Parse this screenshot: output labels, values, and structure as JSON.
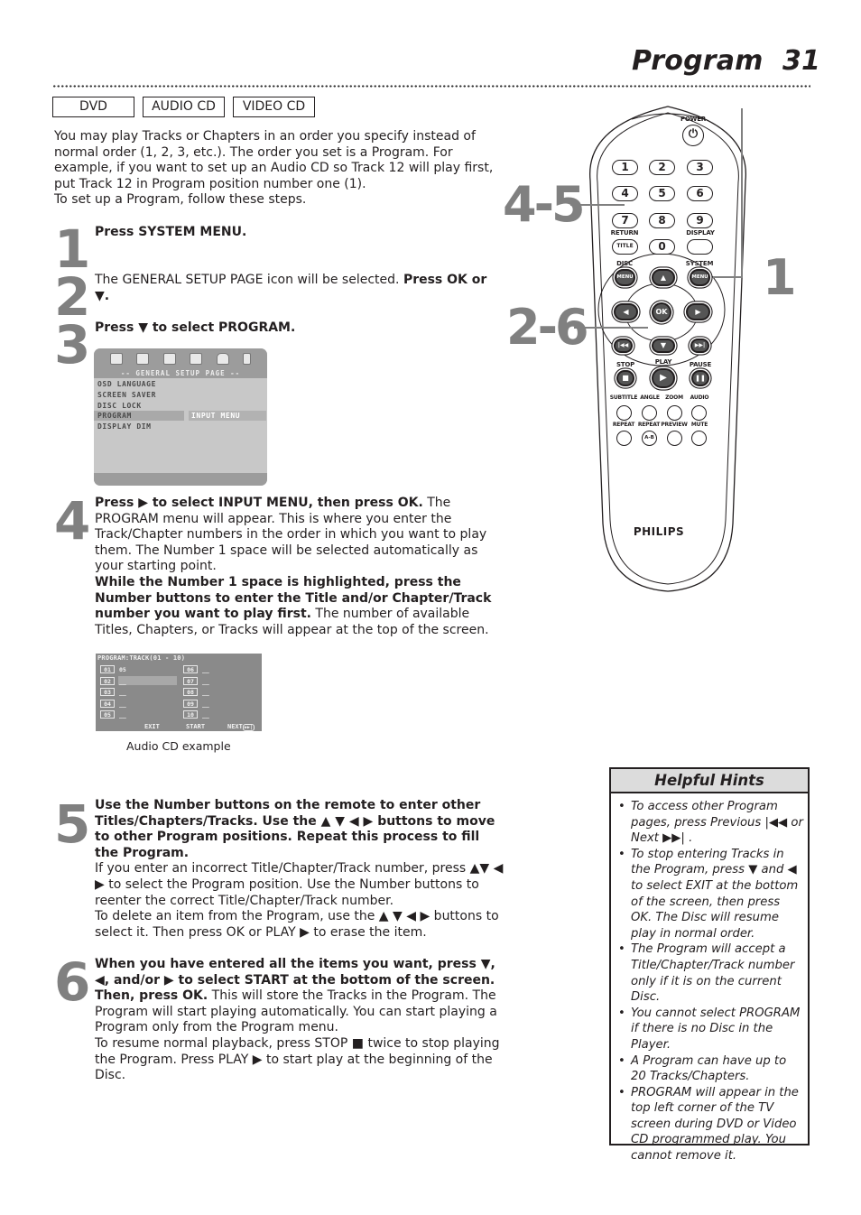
{
  "header": {
    "title": "Program",
    "page_number": "31"
  },
  "disc_types": [
    "DVD",
    "AUDIO CD",
    "VIDEO CD"
  ],
  "intro": {
    "paragraph": "You may play Tracks or Chapters in an order you specify instead of normal order (1, 2, 3, etc.). The order you set is a Program. For example, if you want to set up an Audio CD so Track 12 will play first, put Track 12 in Program position number one (1).",
    "followup": "To set up a Program, follow these steps."
  },
  "steps": [
    {
      "number": "1",
      "bold": "Press SYSTEM MENU.",
      "text": ""
    },
    {
      "number": "2",
      "pre": "The GENERAL SETUP PAGE icon will be selected. ",
      "bold": "Press OK or ▼."
    },
    {
      "number": "3",
      "bold": "Press ▼ to select PROGRAM."
    },
    {
      "number": "4",
      "bold1": "Press ▶ to select INPUT MENU, then press OK.",
      "text1": " The PROGRAM menu will appear. This is where you enter the Track/Chapter numbers in the order in which you want to play them. The Number 1 space will be selected automatically as your starting point.",
      "bold2": "While the Number 1 space is highlighted, press the Number buttons to enter the Title and/or Chapter/Track number you want to play first.",
      "text2": "  The number of available Titles, Chapters, or Tracks will appear at the top of the screen."
    },
    {
      "number": "5",
      "bold": "Use the Number buttons on the remote to enter other Titles/Chapters/Tracks. Use the ▲ ▼ ◀ ▶ buttons to move to other Program positions. Repeat this process to fill the Program.",
      "text1": "If you enter an incorrect Title/Chapter/Track number, press ▲▼ ◀ ▶ to select the Program position. Use the Number buttons to reenter the correct Title/Chapter/Track number.",
      "text2": "To delete an item from the Program, use the ▲ ▼ ◀ ▶ buttons to select it. Then press OK or PLAY ▶ to erase the item."
    },
    {
      "number": "6",
      "bold": "When you have entered all the items you want, press ▼, ◀, and/or ▶ to select START at the bottom of the screen. Then, press OK.",
      "text1": " This will store the Tracks in the Program. The Program will start playing automatically. You can start playing a Program only from the Program menu.",
      "text2": "To resume normal playback, press STOP ■ twice to stop playing the Program. Press PLAY ▶ to start play at the beginning of the Disc."
    }
  ],
  "setup_screen": {
    "header": "-- GENERAL SETUP PAGE --",
    "items": [
      "OSD LANGUAGE",
      "SCREEN SAVER",
      "DISC LOCK",
      "PROGRAM",
      "DISPLAY DIM"
    ],
    "selected": "PROGRAM",
    "submenu": "INPUT MENU",
    "icons": [
      "tv-icon",
      "speaker-icon",
      "dolby-icon",
      "picture-icon",
      "lock-icon",
      "exit-icon"
    ]
  },
  "program_screen": {
    "title": "PROGRAM:TRACK(01 - 10)",
    "slots": [
      {
        "pos": "01",
        "value": "05"
      },
      {
        "pos": "02",
        "value": "__"
      },
      {
        "pos": "03",
        "value": "__"
      },
      {
        "pos": "04",
        "value": "__"
      },
      {
        "pos": "05",
        "value": "__"
      },
      {
        "pos": "06",
        "value": "__"
      },
      {
        "pos": "07",
        "value": "__"
      },
      {
        "pos": "08",
        "value": "__"
      },
      {
        "pos": "09",
        "value": "__"
      },
      {
        "pos": "10",
        "value": "__"
      }
    ],
    "footer": {
      "exit": "EXIT",
      "start": "START",
      "next": "NEXT"
    },
    "caption": "Audio CD example"
  },
  "hints": {
    "title": "Helpful Hints",
    "items": [
      "To access other Program pages, press Previous |◀◀ or Next ▶▶| .",
      "To stop entering Tracks in the Program, press ▼ and ◀ to select EXIT at the bottom of the screen, then press OK. The Disc will resume play in normal order.",
      "The Program will accept a Title/Chapter/Track number only if it is on the current Disc.",
      "You cannot select PROGRAM if there is no Disc in the Player.",
      "A Program can have up to 20 Tracks/Chapters.",
      "PROGRAM will appear in the top left corner of the TV screen during DVD or Video CD programmed play. You cannot remove it."
    ]
  },
  "remote": {
    "brand": "PHILIPS",
    "callouts": [
      "4-5",
      "2-6",
      "1"
    ],
    "labels": {
      "power": "POWER",
      "return": "RETURN",
      "display": "DISPLAY",
      "title": "TITLE",
      "disc": "DISC",
      "system": "SYSTEM",
      "menu": "MENU",
      "ok": "OK",
      "stop": "STOP",
      "play": "PLAY",
      "pause": "PAUSE",
      "subtitle": "SUBTITLE",
      "angle": "ANGLE",
      "zoom": "ZOOM",
      "audio": "AUDIO",
      "repeat": "REPEAT",
      "repeat_ab": "REPEAT",
      "ab": "A-B",
      "preview": "PREVIEW",
      "mute": "MUTE"
    },
    "digits": [
      "1",
      "2",
      "3",
      "4",
      "5",
      "6",
      "7",
      "8",
      "9",
      "0"
    ]
  }
}
